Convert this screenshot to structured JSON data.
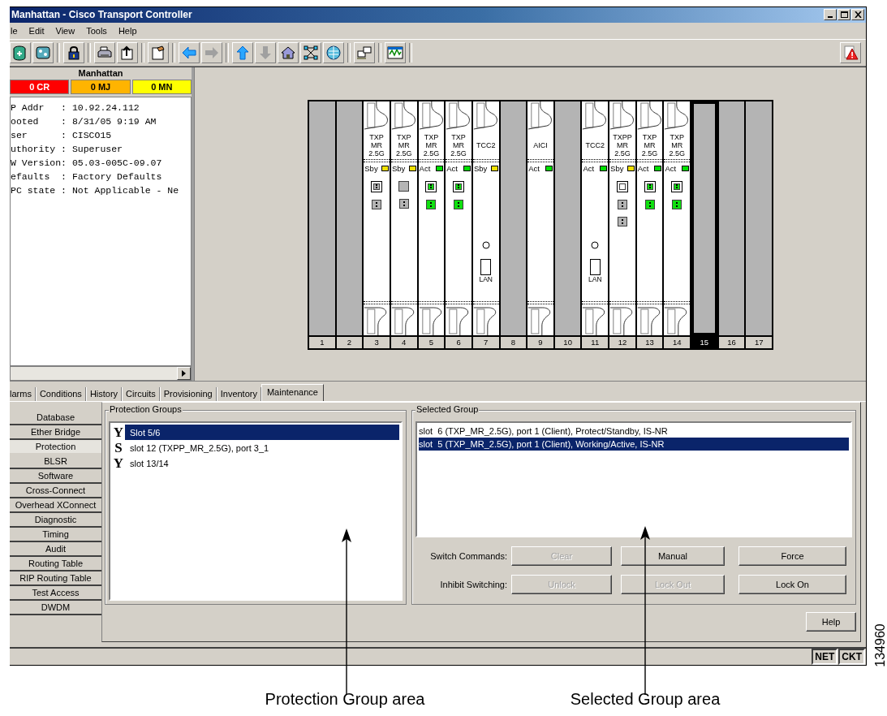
{
  "window": {
    "title": "Manhattan - Cisco Transport Controller"
  },
  "menu": [
    "le",
    "Edit",
    "View",
    "Tools",
    "Help"
  ],
  "node_panel": {
    "name": "Manhattan",
    "alarms": [
      {
        "kind": "critical",
        "label": "0 CR",
        "color": "#ff0000"
      },
      {
        "kind": "major",
        "label": "0 MJ",
        "color": "#ffb400"
      },
      {
        "kind": "minor",
        "label": "0 MN",
        "color": "#ffff00"
      }
    ],
    "info_lines": [
      "P Addr   : 10.92.24.112",
      "ooted    : 8/31/05 9:19 AM",
      "ser      : CISCO15",
      "uthority : Superuser",
      "W Version: 05.03-005C-09.07",
      "efaults  : Factory Defaults",
      "PC state : Not Applicable - Ne"
    ]
  },
  "shelf": {
    "slots": [
      {
        "number": "1",
        "kind": "empty",
        "selected": false
      },
      {
        "number": "2",
        "kind": "empty",
        "selected": false
      },
      {
        "number": "3",
        "kind": "txp",
        "selected": false,
        "label": [
          "TXP",
          "MR",
          "2.5G"
        ],
        "status": "Sby",
        "color": "#f0e000",
        "ports": [
          {
            "kind": "sfp",
            "on": false
          },
          {
            "kind": "jack",
            "on": false
          }
        ]
      },
      {
        "number": "4",
        "kind": "txp",
        "selected": false,
        "label": [
          "TXP",
          "MR",
          "2.5G"
        ],
        "status": "Sby",
        "color": "#f0e000",
        "ports": [
          {
            "kind": "blank",
            "on": false
          },
          {
            "kind": "jack",
            "on": false
          }
        ]
      },
      {
        "number": "5",
        "kind": "txp",
        "selected": false,
        "label": [
          "TXP",
          "MR",
          "2.5G"
        ],
        "status": "Act",
        "color": "#00e000",
        "ports": [
          {
            "kind": "sfp",
            "on": true
          },
          {
            "kind": "jack",
            "on": true
          }
        ]
      },
      {
        "number": "6",
        "kind": "txp",
        "selected": false,
        "label": [
          "TXP",
          "MR",
          "2.5G"
        ],
        "status": "Act",
        "color": "#00e000",
        "ports": [
          {
            "kind": "sfp",
            "on": true
          },
          {
            "kind": "jack",
            "on": true
          }
        ]
      },
      {
        "number": "7",
        "kind": "tcc",
        "selected": false,
        "label": [
          "TCC2"
        ],
        "status": "Sby",
        "color": "#f0e000",
        "lan_label": "LAN"
      },
      {
        "number": "8",
        "kind": "empty",
        "selected": false
      },
      {
        "number": "9",
        "kind": "aic",
        "selected": false,
        "label": [
          "AICI"
        ],
        "status": "Act",
        "color": "#00e000"
      },
      {
        "number": "10",
        "kind": "empty",
        "selected": false
      },
      {
        "number": "11",
        "kind": "tcc",
        "selected": false,
        "label": [
          "TCC2"
        ],
        "status": "Act",
        "color": "#00e000",
        "lan_label": "LAN"
      },
      {
        "number": "12",
        "kind": "txp",
        "selected": false,
        "label": [
          "TXPP",
          "MR",
          "2.5G"
        ],
        "status": "Sby",
        "color": "#f0e000",
        "ports": [
          {
            "kind": "sfp-empty",
            "on": false
          },
          {
            "kind": "jack",
            "on": false
          },
          {
            "kind": "jack",
            "on": false
          }
        ]
      },
      {
        "number": "13",
        "kind": "txp",
        "selected": false,
        "label": [
          "TXP",
          "MR",
          "2.5G"
        ],
        "status": "Act",
        "color": "#00e000",
        "ports": [
          {
            "kind": "sfp",
            "on": true
          },
          {
            "kind": "jack",
            "on": true
          }
        ]
      },
      {
        "number": "14",
        "kind": "txp",
        "selected": false,
        "label": [
          "TXP",
          "MR",
          "2.5G"
        ],
        "status": "Act",
        "color": "#00e000",
        "ports": [
          {
            "kind": "sfp",
            "on": true
          },
          {
            "kind": "jack",
            "on": true
          }
        ]
      },
      {
        "number": "15",
        "kind": "empty",
        "selected": true
      },
      {
        "number": "16",
        "kind": "empty",
        "selected": false
      },
      {
        "number": "17",
        "kind": "empty",
        "selected": false
      }
    ]
  },
  "tabs": [
    {
      "label": "larms",
      "selected": false
    },
    {
      "label": "Conditions",
      "selected": false
    },
    {
      "label": "History",
      "selected": false
    },
    {
      "label": "Circuits",
      "selected": false
    },
    {
      "label": "Provisioning",
      "selected": false
    },
    {
      "label": "Inventory",
      "selected": false
    },
    {
      "label": "Maintenance",
      "selected": true
    }
  ],
  "sidebar": {
    "items": [
      {
        "label": "Database",
        "selected": false
      },
      {
        "label": "Ether Bridge",
        "selected": false
      },
      {
        "label": "Protection",
        "selected": true
      },
      {
        "label": "BLSR",
        "selected": false
      },
      {
        "label": "Software",
        "selected": false
      },
      {
        "label": "Cross-Connect",
        "selected": false
      },
      {
        "label": "Overhead XConnect",
        "selected": false
      },
      {
        "label": "Diagnostic",
        "selected": false
      },
      {
        "label": "Timing",
        "selected": false
      },
      {
        "label": "Audit",
        "selected": false
      },
      {
        "label": "Routing Table",
        "selected": false
      },
      {
        "label": "RIP Routing Table",
        "selected": false
      },
      {
        "label": "Test Access",
        "selected": false
      },
      {
        "label": "DWDM",
        "selected": false
      }
    ]
  },
  "protection_groups": {
    "title": "Protection Groups",
    "items": [
      {
        "glyph": "Y",
        "label": "Slot 5/6",
        "selected": true
      },
      {
        "glyph": "S",
        "label": "slot 12 (TXPP_MR_2.5G), port 3_1",
        "selected": false
      },
      {
        "glyph": "Y",
        "label": "slot 13/14",
        "selected": false
      }
    ]
  },
  "selected_group": {
    "title": "Selected Group",
    "items": [
      {
        "label": "slot  6 (TXP_MR_2.5G), port 1 (Client), Protect/Standby, IS-NR",
        "selected": false
      },
      {
        "label": "slot  5 (TXP_MR_2.5G), port 1 (Client), Working/Active, IS-NR",
        "selected": true
      }
    ],
    "command_rows": [
      {
        "label": "Switch Commands:",
        "buttons": [
          {
            "label": "Clear",
            "disabled": true
          },
          {
            "label": "Manual",
            "disabled": false
          },
          {
            "label": "Force",
            "disabled": false
          }
        ]
      },
      {
        "label": "Inhibit Switching:",
        "buttons": [
          {
            "label": "Unlock",
            "disabled": true
          },
          {
            "label": "Lock Out",
            "disabled": true
          },
          {
            "label": "Lock On",
            "disabled": false
          }
        ]
      }
    ]
  },
  "help_button": "Help",
  "status_bar": {
    "indicators": [
      "NET",
      "CKT"
    ]
  },
  "annotations": [
    {
      "label": "Protection Group area"
    },
    {
      "label": "Selected Group area"
    }
  ],
  "figure_number": "134960"
}
